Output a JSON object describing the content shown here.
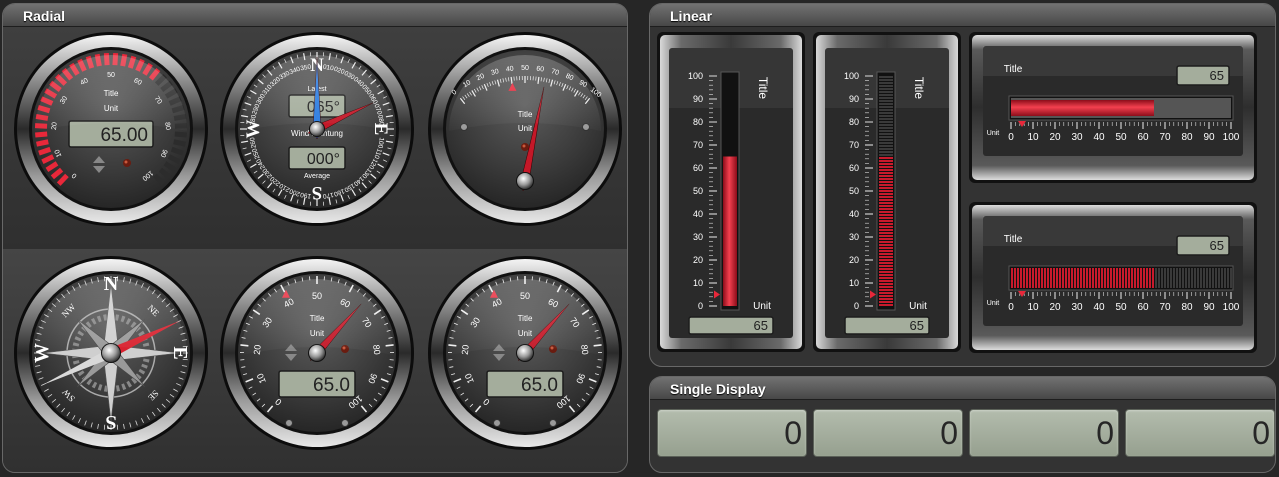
{
  "radial": {
    "title": "Radial",
    "gauge1": {
      "title": "Title",
      "unit": "Unit",
      "display": "65.00",
      "value": 65,
      "ticks": [
        "0",
        "10",
        "20",
        "30",
        "40",
        "50",
        "60",
        "70",
        "80",
        "90",
        "100"
      ]
    },
    "wind": {
      "latest_label": "Latest",
      "latest_value": "065°",
      "title": "Wind Richtung",
      "average_value": "000°",
      "average_label": "Average",
      "cardinals": [
        "N",
        "E",
        "S",
        "W"
      ],
      "degree_labels": [
        "010",
        "020",
        "030",
        "040",
        "050",
        "060",
        "070",
        "080",
        "100",
        "110",
        "120",
        "130",
        "140",
        "150",
        "160",
        "170",
        "190",
        "200",
        "210",
        "220",
        "230",
        "240",
        "250",
        "260",
        "280",
        "290",
        "300",
        "310",
        "320",
        "330",
        "340",
        "350"
      ],
      "latest_deg": 65,
      "average_deg": 0
    },
    "gauge3": {
      "title": "Title",
      "unit": "Unit",
      "value": 65,
      "ticks": [
        "0",
        "10",
        "20",
        "30",
        "40",
        "50",
        "60",
        "70",
        "80",
        "90",
        "100"
      ]
    },
    "compass": {
      "cardinals": [
        "N",
        "E",
        "S",
        "W"
      ],
      "intercardinals": [
        "NE",
        "SE",
        "SW",
        "NW"
      ],
      "heading_deg": 65
    },
    "gauge5": {
      "title": "Title",
      "unit": "Unit",
      "display": "65.0",
      "value": 65,
      "ticks": [
        "0",
        "10",
        "20",
        "30",
        "40",
        "50",
        "60",
        "70",
        "80",
        "90",
        "100"
      ]
    },
    "gauge6": {
      "title": "Title",
      "unit": "Unit",
      "display": "65.0",
      "value": 65,
      "ticks": [
        "0",
        "10",
        "20",
        "30",
        "40",
        "50",
        "60",
        "70",
        "80",
        "90",
        "100"
      ]
    }
  },
  "linear": {
    "title": "Linear",
    "vert1": {
      "title": "Title",
      "unit": "Unit",
      "display": "65",
      "value": 65,
      "ticks": [
        "0",
        "10",
        "20",
        "30",
        "40",
        "50",
        "60",
        "70",
        "80",
        "90",
        "100"
      ]
    },
    "vert2": {
      "title": "Title",
      "unit": "Unit",
      "display": "65",
      "value": 65,
      "ticks": [
        "0",
        "10",
        "20",
        "30",
        "40",
        "50",
        "60",
        "70",
        "80",
        "90",
        "100"
      ]
    },
    "horiz1": {
      "title": "Title",
      "unit": "Unit",
      "display": "65",
      "value": 65,
      "ticks": [
        "0",
        "10",
        "20",
        "30",
        "40",
        "50",
        "60",
        "70",
        "80",
        "90",
        "100"
      ]
    },
    "horiz2": {
      "title": "Title",
      "unit": "Unit",
      "display": "65",
      "value": 65,
      "ticks": [
        "0",
        "10",
        "20",
        "30",
        "40",
        "50",
        "60",
        "70",
        "80",
        "90",
        "100"
      ]
    }
  },
  "single": {
    "title": "Single Display",
    "values": [
      "0",
      "0",
      "0",
      "0"
    ]
  },
  "colors": {
    "accent_red": "#e8283a",
    "lcd": "#a4ad9c",
    "needle_blue": "#2a7be0"
  }
}
